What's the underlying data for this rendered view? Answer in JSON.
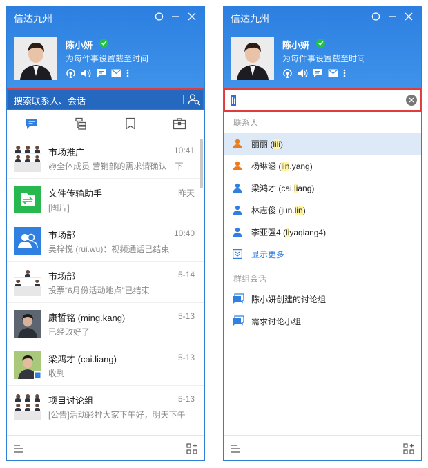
{
  "left": {
    "app_title": "信达九州",
    "user_name": "陈小妍",
    "signature": "为每件事设置截至时间",
    "search_placeholder": "搜索联系人、会话",
    "conversations": [
      {
        "name": "市场推广",
        "time": "10:41",
        "msg": "@全体成员 营销部的需求请确认一下",
        "avatar": "group-photo"
      },
      {
        "name": "文件传输助手",
        "time": "昨天",
        "msg": "[图片]",
        "avatar": "file-transfer"
      },
      {
        "name": "市场部",
        "time": "10:40",
        "msg": "吴梓悦 (rui.wu)：视频通话已结束",
        "avatar": "department"
      },
      {
        "name": "市场部",
        "time": "5-14",
        "msg": "投票“6月份活动地点”已结束",
        "avatar": "group-photo"
      },
      {
        "name": "康哲铭 (ming.kang)",
        "time": "5-13",
        "msg": "已经改好了",
        "avatar": "person-photo"
      },
      {
        "name": "梁鸿才 (cai.liang)",
        "time": "5-13",
        "msg": "收到",
        "avatar": "person-photo"
      },
      {
        "name": "项目讨论组",
        "time": "5-13",
        "msg": "[公告]活动彩排大家下午好，明天下午…",
        "avatar": "group-photo"
      }
    ]
  },
  "right": {
    "app_title": "信达九州",
    "user_name": "陈小妍",
    "signature": "为每件事设置截至时间",
    "search_value": "li",
    "contacts_header": "联系人",
    "contacts": [
      {
        "name": "丽丽",
        "pre": " (",
        "hl": "lili",
        "post": ")",
        "icon_color": "#f07a1a"
      },
      {
        "name": "杨琳涵",
        "pre": " (",
        "hl": "lin",
        "post": ".yang)",
        "icon_color": "#f07a1a"
      },
      {
        "name": "梁鸿才",
        "pre": " (cai.",
        "hl": "li",
        "post": "ang)",
        "icon_color": "#2f80e0"
      },
      {
        "name": "林志俊",
        "pre": " (jun.",
        "hl": "lin",
        "post": ")",
        "icon_color": "#2f80e0"
      },
      {
        "name": "李亚强4",
        "pre": " (",
        "hl": "li",
        "post": "yaqiang4)",
        "icon_color": "#2f80e0"
      }
    ],
    "show_more": "显示更多",
    "groups_header": "群组会话",
    "groups": [
      {
        "name": "陈小妍创建的讨论组"
      },
      {
        "name": "需求讨论小组"
      }
    ]
  },
  "colors": {
    "accent": "#2f80e0",
    "header": "#3a8ee8",
    "search_dark": "#2568bf",
    "highlight_box": "#e03c3c",
    "online": "#22c04a"
  }
}
